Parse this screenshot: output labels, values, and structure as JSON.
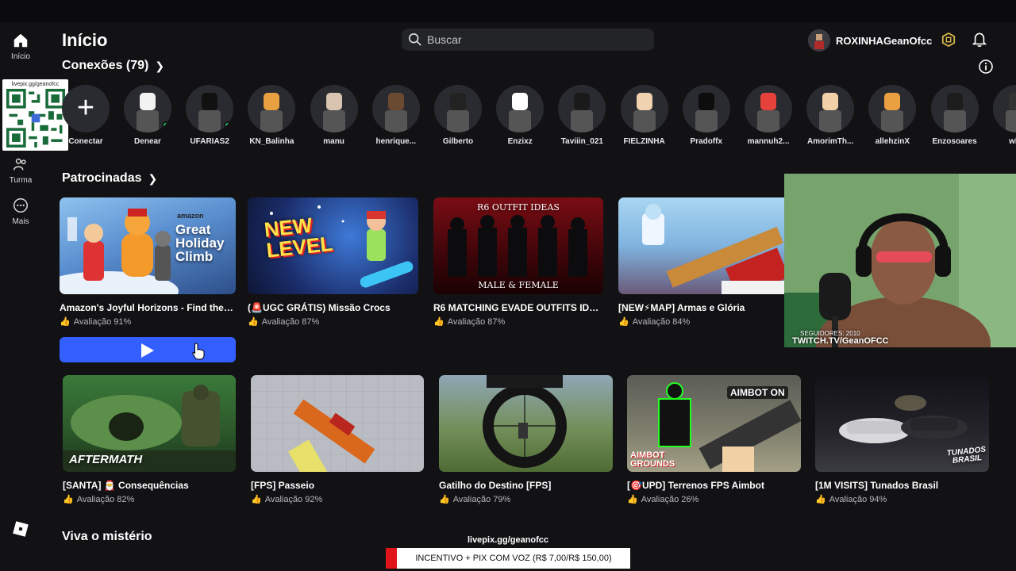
{
  "header": {
    "title": "Início",
    "search_placeholder": "Buscar",
    "username": "ROXINHAGeanOfcc"
  },
  "rail": {
    "items": [
      {
        "label": "Início",
        "icon": "home-icon"
      },
      {
        "label": "Turma",
        "icon": "group-icon"
      },
      {
        "label": "Mais",
        "icon": "more-icon"
      }
    ]
  },
  "qr": {
    "url": "livepix.gg/geanofcc"
  },
  "connections": {
    "title": "Conexões (79)",
    "add_label": "Conectar",
    "people": [
      {
        "name": "Denear",
        "online": true
      },
      {
        "name": "UFARIAS2",
        "online": true
      },
      {
        "name": "KN_Balinha",
        "online": false
      },
      {
        "name": "manu",
        "online": false
      },
      {
        "name": "henrique...",
        "online": false
      },
      {
        "name": "Gilberto",
        "online": false
      },
      {
        "name": "Enzixz",
        "online": false
      },
      {
        "name": "Taviiin_021",
        "online": false
      },
      {
        "name": "FIELZINHA",
        "online": false
      },
      {
        "name": "Pradoffx",
        "online": false
      },
      {
        "name": "mannuh2...",
        "online": false
      },
      {
        "name": "AmorimTh...",
        "online": false
      },
      {
        "name": "allehzinX",
        "online": false
      },
      {
        "name": "Enzosoares",
        "online": false
      },
      {
        "name": "wha",
        "online": false
      }
    ]
  },
  "sponsored": {
    "title": "Patrocinadas",
    "games": [
      {
        "name": "Amazon's Joyful Horizons - Find the Sti...",
        "rating": "Avaliação 91%",
        "thumb_text": "Great Holiday Climb",
        "thumb_sub": "amazon"
      },
      {
        "name": "(🚨UGC GRÁTIS) Missão Crocs",
        "rating": "Avaliação 87%",
        "thumb_text": "NEW LEVEL"
      },
      {
        "name": "R6 MATCHING EVADE OUTFITS IDEAS",
        "rating": "Avaliação 87%",
        "thumb_text": "R6 OUTFIT IDEAS",
        "thumb_sub": "MALE & FEMALE"
      },
      {
        "name": "[NEW⚡MAP] Armas e Glória",
        "rating": "Avaliação 84%"
      }
    ]
  },
  "row2": {
    "games": [
      {
        "name": "[SANTA] 🎅 Consequências",
        "rating": "Avaliação 82%",
        "thumb_text": "AFTERMATH"
      },
      {
        "name": "[FPS] Passeio",
        "rating": "Avaliação 92%"
      },
      {
        "name": "Gatilho do Destino [FPS]",
        "rating": "Avaliação 79%"
      },
      {
        "name": "[🎯UPD] Terrenos FPS Aimbot",
        "rating": "Avaliação 26%",
        "thumb_text": "AIMBOT ON",
        "thumb_sub": "AIMBOT GROUNDS"
      },
      {
        "name": "[1M VISITS] Tunados Brasil",
        "rating": "Avaliação 94%",
        "thumb_text": "TUNADOS BRASIL"
      }
    ]
  },
  "mystery": {
    "title": "Viva o mistério"
  },
  "webcam": {
    "overlay_text": "TWITCH.TV/GeanOFCC",
    "overlay_sub": "SEGUIDORES: 2010"
  },
  "stream": {
    "livepix_url": "livepix.gg/geanofcc",
    "incentivo": "INCENTIVO + PIX COM VOZ (R$ 7,00/R$ 150,00)"
  },
  "colors": {
    "accent": "#335fff",
    "online": "#2ecc71",
    "background": "#121215"
  }
}
